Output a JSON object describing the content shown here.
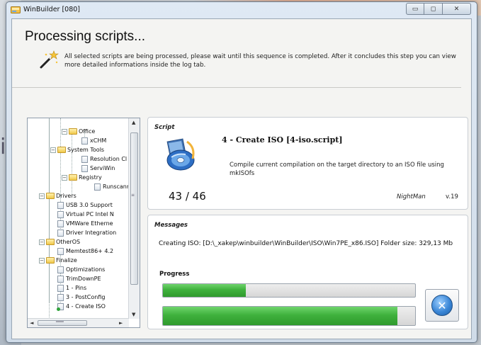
{
  "window": {
    "title": "WinBuilder [080]"
  },
  "header": {
    "title": "Processing scripts...",
    "description": "All selected scripts are being processed, please wait until this sequence is completed. After it concludes this step you can view more detailed informations inside the log tab."
  },
  "background": {
    "partial_word": "ii"
  },
  "tree": {
    "nodes": [
      {
        "label": "Office",
        "kind": "folder"
      },
      {
        "label": "xCHM",
        "kind": "script"
      },
      {
        "label": "System Tools",
        "kind": "folder"
      },
      {
        "label": "Resolution Cl",
        "kind": "script"
      },
      {
        "label": "ServiWin",
        "kind": "script"
      },
      {
        "label": "Registry",
        "kind": "folder"
      },
      {
        "label": "Runscanr",
        "kind": "script"
      },
      {
        "label": "Drivers",
        "kind": "folder"
      },
      {
        "label": "USB 3.0 Support",
        "kind": "script"
      },
      {
        "label": "Virtual PC Intel N",
        "kind": "script"
      },
      {
        "label": "VMWare Etherne",
        "kind": "script"
      },
      {
        "label": "Driver Integration",
        "kind": "script"
      },
      {
        "label": "OtherOS",
        "kind": "folder"
      },
      {
        "label": "Memtest86+ 4.2",
        "kind": "script"
      },
      {
        "label": "Finalize",
        "kind": "folder"
      },
      {
        "label": "Optimizations",
        "kind": "script"
      },
      {
        "label": "TrimDownPE",
        "kind": "script"
      },
      {
        "label": "1 - Pins",
        "kind": "script"
      },
      {
        "label": "3 - PostConfig",
        "kind": "script"
      },
      {
        "label": "4 - Create ISO",
        "kind": "script"
      }
    ],
    "scroll_glyphs": {
      "up": "▲",
      "down": "▼",
      "left": "◄",
      "right": "►",
      "grip": "≡",
      "hgrip": "═══"
    }
  },
  "script": {
    "label": "Script",
    "name": "4 - Create ISO [4-iso.script]",
    "description": "Compile current compilation on the target directory to an ISO file using mkISOfs",
    "counter": "43 / 46",
    "author": "NightMan",
    "version": "v.19"
  },
  "messages": {
    "label": "Messages",
    "text": "Creating ISO: [D:\\_xakep\\winbuilder\\WinBuilder\\ISO\\Win7PE_x86.ISO] Folder size: 329,13 Mb",
    "progress_label": "Progress",
    "progress_script": 0.33,
    "progress_total": 0.93
  },
  "icons": {
    "app": "winbuilder-icon",
    "wand": "magic-wand-icon",
    "cd": "cd-disc-icon",
    "cancel": "cancel-x-icon",
    "minimize": "minimize-icon",
    "maximize": "maximize-icon",
    "close": "close-icon"
  },
  "glyphs": {
    "minimize": "▭",
    "maximize": "◻",
    "close": "✕",
    "cancel": "✕"
  }
}
